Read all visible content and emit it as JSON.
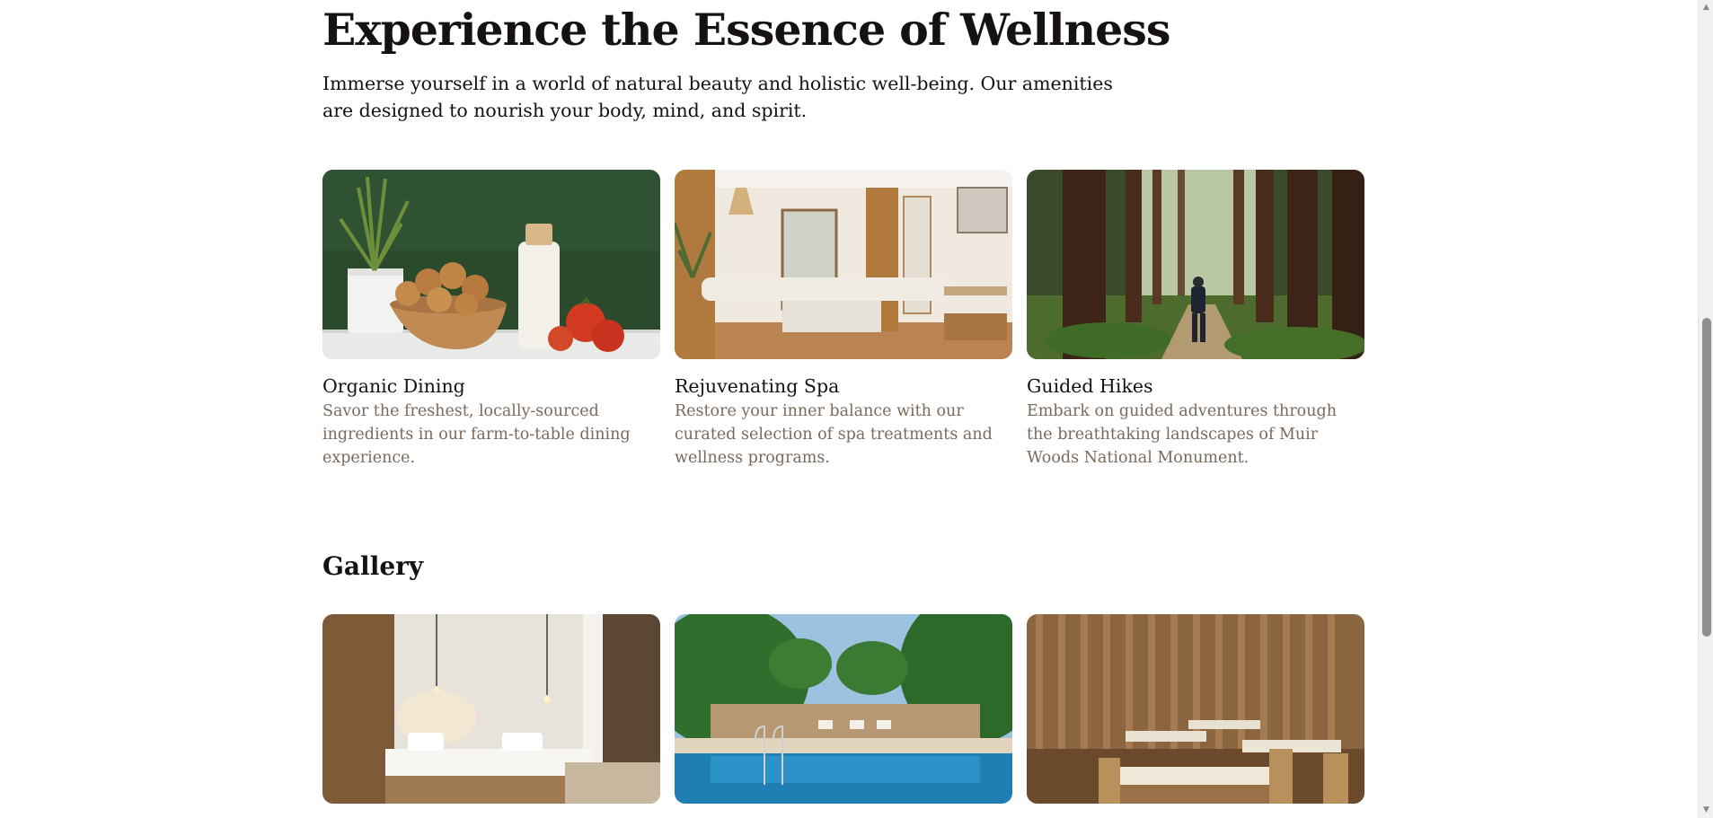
{
  "hero": {
    "title": "Experience the Essence of Wellness",
    "text": "Immerse yourself in a world of natural beauty and holistic well-being. Our amenities are designed to nourish your body, mind, and spirit."
  },
  "amenities": [
    {
      "title": "Organic Dining",
      "text": "Savor the freshest, locally-sourced ingredients in our farm-to-table dining experience."
    },
    {
      "title": "Rejuvenating Spa",
      "text": "Restore your inner balance with our curated selection of spa treatments and wellness programs."
    },
    {
      "title": "Guided Hikes",
      "text": "Embark on guided adventures through the breathtaking landscapes of Muir Woods National Monument."
    }
  ],
  "gallery": {
    "title": "Gallery"
  },
  "scrollbar": {
    "up_icon": "▲",
    "down_icon": "▼"
  }
}
